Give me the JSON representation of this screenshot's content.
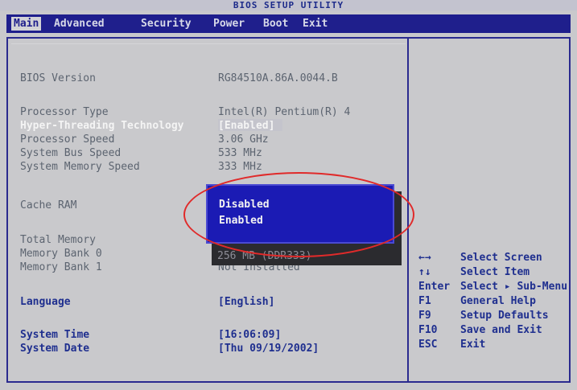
{
  "title": "BIOS SETUP UTILITY",
  "menu": [
    "Main",
    "Advanced",
    "Security",
    "Power",
    "Boot",
    "Exit"
  ],
  "rows": [
    {
      "label": "BIOS Version",
      "value": "RG84510A.86A.0044.B"
    },
    {
      "label": "Processor Type",
      "value": "Intel(R) Pentium(R) 4"
    },
    {
      "label": "Hyper-Threading Technology",
      "value": "[Enabled]"
    },
    {
      "label": "Processor Speed",
      "value": "3.06 GHz"
    },
    {
      "label": "System Bus Speed",
      "value": "533 MHz"
    },
    {
      "label": "System Memory Speed",
      "value": "333 MHz"
    },
    {
      "label": "Cache RAM",
      "value": ""
    },
    {
      "label": "Total Memory",
      "value": ""
    },
    {
      "label": "Memory Bank 0",
      "value": "256 MB (DDR333)"
    },
    {
      "label": "Memory Bank 1",
      "value": "Not Installed"
    },
    {
      "label": "Language",
      "value": "[English]"
    },
    {
      "label": "System Time",
      "value": "[16:06:09]"
    },
    {
      "label": "System Date",
      "value": "[Thu 09/19/2002]"
    }
  ],
  "popup": {
    "options": [
      "Disabled",
      "Enabled"
    ]
  },
  "help": [
    {
      "key": "←→",
      "text": "Select Screen"
    },
    {
      "key": "↑↓",
      "text": "Select Item"
    },
    {
      "key": "Enter",
      "text": "Select ▸ Sub-Menu"
    },
    {
      "key": "F1",
      "text": "General Help"
    },
    {
      "key": "F9",
      "text": "Setup Defaults"
    },
    {
      "key": "F10",
      "text": "Save and Exit"
    },
    {
      "key": "ESC",
      "text": "Exit"
    }
  ]
}
